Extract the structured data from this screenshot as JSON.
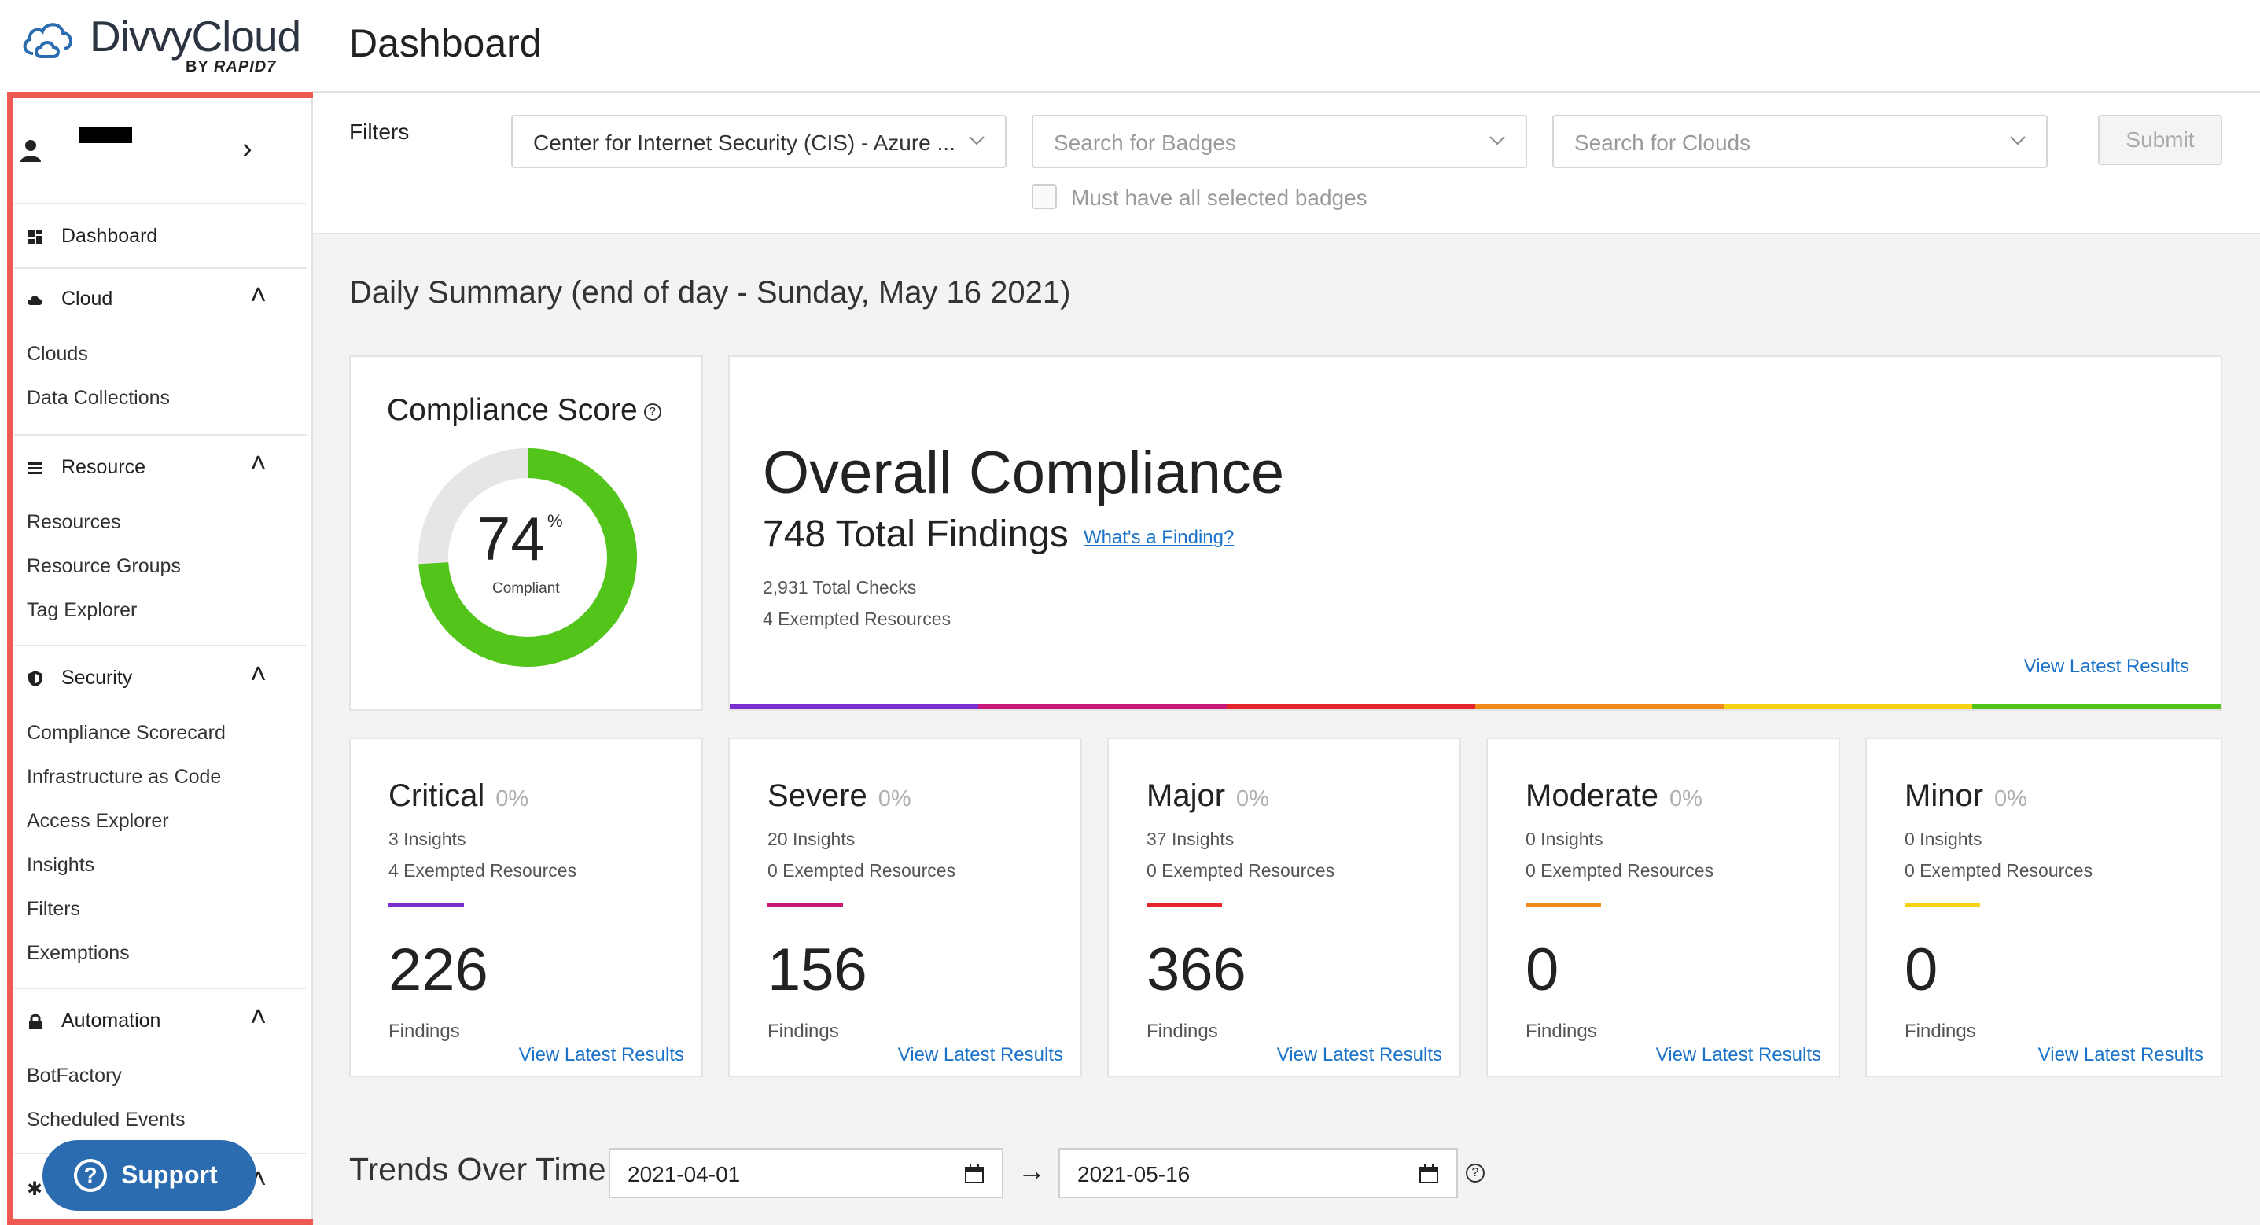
{
  "logo": {
    "name": "DivvyCloud",
    "sub_prefix": "BY",
    "sub_brand": "RAPID7"
  },
  "header": {
    "title": "Dashboard"
  },
  "sidebar": {
    "user_chevron": "›",
    "dashboard": "Dashboard",
    "sections": [
      {
        "label": "Cloud",
        "items": [
          "Clouds",
          "Data Collections"
        ]
      },
      {
        "label": "Resource",
        "items": [
          "Resources",
          "Resource Groups",
          "Tag Explorer"
        ]
      },
      {
        "label": "Security",
        "items": [
          "Compliance Scorecard",
          "Infrastructure as Code",
          "Access Explorer",
          "Insights",
          "Filters",
          "Exemptions"
        ]
      },
      {
        "label": "Automation",
        "items": [
          "BotFactory",
          "Scheduled Events"
        ]
      }
    ],
    "support": "Support",
    "highlight_color": "#ee5a52"
  },
  "filters": {
    "label": "Filters",
    "pack_value": "Center for Internet Security (CIS) - Azure ...",
    "badges_placeholder": "Search for Badges",
    "clouds_placeholder": "Search for Clouds",
    "must_have_all": "Must have all selected badges",
    "submit": "Submit"
  },
  "summary": {
    "title": "Daily Summary (end of day - Sunday, May 16 2021)",
    "compliance_score_title": "Compliance Score",
    "compliance_score": "74",
    "compliance_fraction": 0.74,
    "compliance_pct_sign": "%",
    "compliance_label": "Compliant",
    "overall_title": "Overall Compliance",
    "total_findings": "748 Total Findings",
    "finding_link": "What's a Finding?",
    "total_checks": "2,931 Total Checks",
    "exempted": "4 Exempted Resources",
    "view_latest": "View Latest Results",
    "colors": {
      "green": "#52c41a",
      "gray": "#e6e6e6",
      "link": "#1a73c8"
    }
  },
  "severities": [
    {
      "name": "Critical",
      "pct": "0%",
      "insights": "3 Insights",
      "exempted": "4 Exempted Resources",
      "count": "226",
      "findings_label": "Findings",
      "view": "View Latest Results",
      "color": "#7b2fd0"
    },
    {
      "name": "Severe",
      "pct": "0%",
      "insights": "20 Insights",
      "exempted": "0 Exempted Resources",
      "count": "156",
      "findings_label": "Findings",
      "view": "View Latest Results",
      "color": "#c8197a"
    },
    {
      "name": "Major",
      "pct": "0%",
      "insights": "37 Insights",
      "exempted": "0 Exempted Resources",
      "count": "366",
      "findings_label": "Findings",
      "view": "View Latest Results",
      "color": "#e3262c"
    },
    {
      "name": "Moderate",
      "pct": "0%",
      "insights": "0 Insights",
      "exempted": "0 Exempted Resources",
      "count": "0",
      "findings_label": "Findings",
      "view": "View Latest Results",
      "color": "#f28a1e"
    },
    {
      "name": "Minor",
      "pct": "0%",
      "insights": "0 Insights",
      "exempted": "0 Exempted Resources",
      "count": "0",
      "findings_label": "Findings",
      "view": "View Latest Results",
      "color": "#f5d214"
    }
  ],
  "trends": {
    "title": "Trends Over Time",
    "start": "2021-04-01",
    "end": "2021-05-16"
  }
}
